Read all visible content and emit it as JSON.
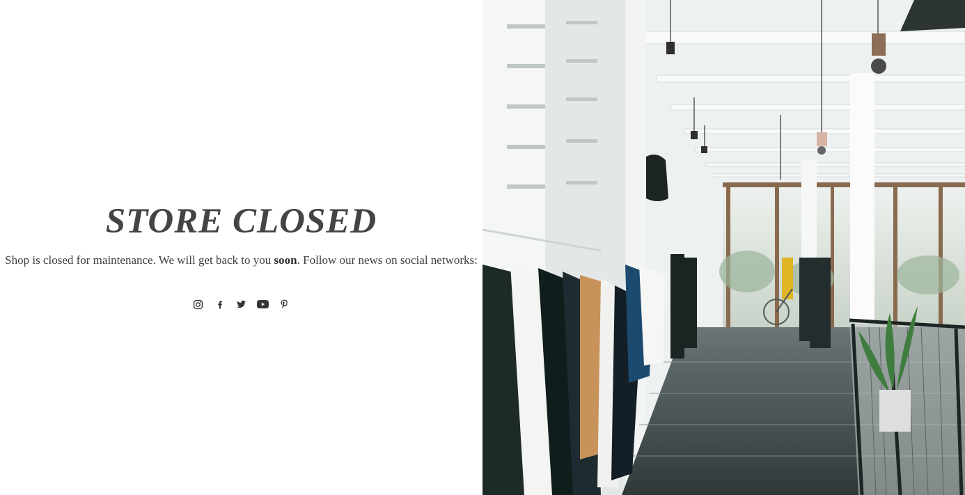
{
  "page": {
    "title": "STORE CLOSED",
    "message_before": "Shop is closed for maintenance. We will get back to you ",
    "message_bold": "soon",
    "message_after": ". Follow our news on social networks:"
  },
  "social": [
    {
      "name": "instagram",
      "icon": "instagram-icon"
    },
    {
      "name": "facebook",
      "icon": "facebook-icon"
    },
    {
      "name": "twitter",
      "icon": "twitter-icon"
    },
    {
      "name": "youtube",
      "icon": "youtube-icon"
    },
    {
      "name": "pinterest",
      "icon": "pinterest-icon"
    }
  ],
  "hero_image": {
    "subject": "clothing store interior with garment racks",
    "colors": {
      "wall": "#f2f4f4",
      "floor": "#3d4848",
      "beam": "#1f2a2a"
    }
  },
  "colors": {
    "title": "#444444",
    "text": "#3e3e3e",
    "icon": "#333333",
    "background": "#ffffff"
  }
}
